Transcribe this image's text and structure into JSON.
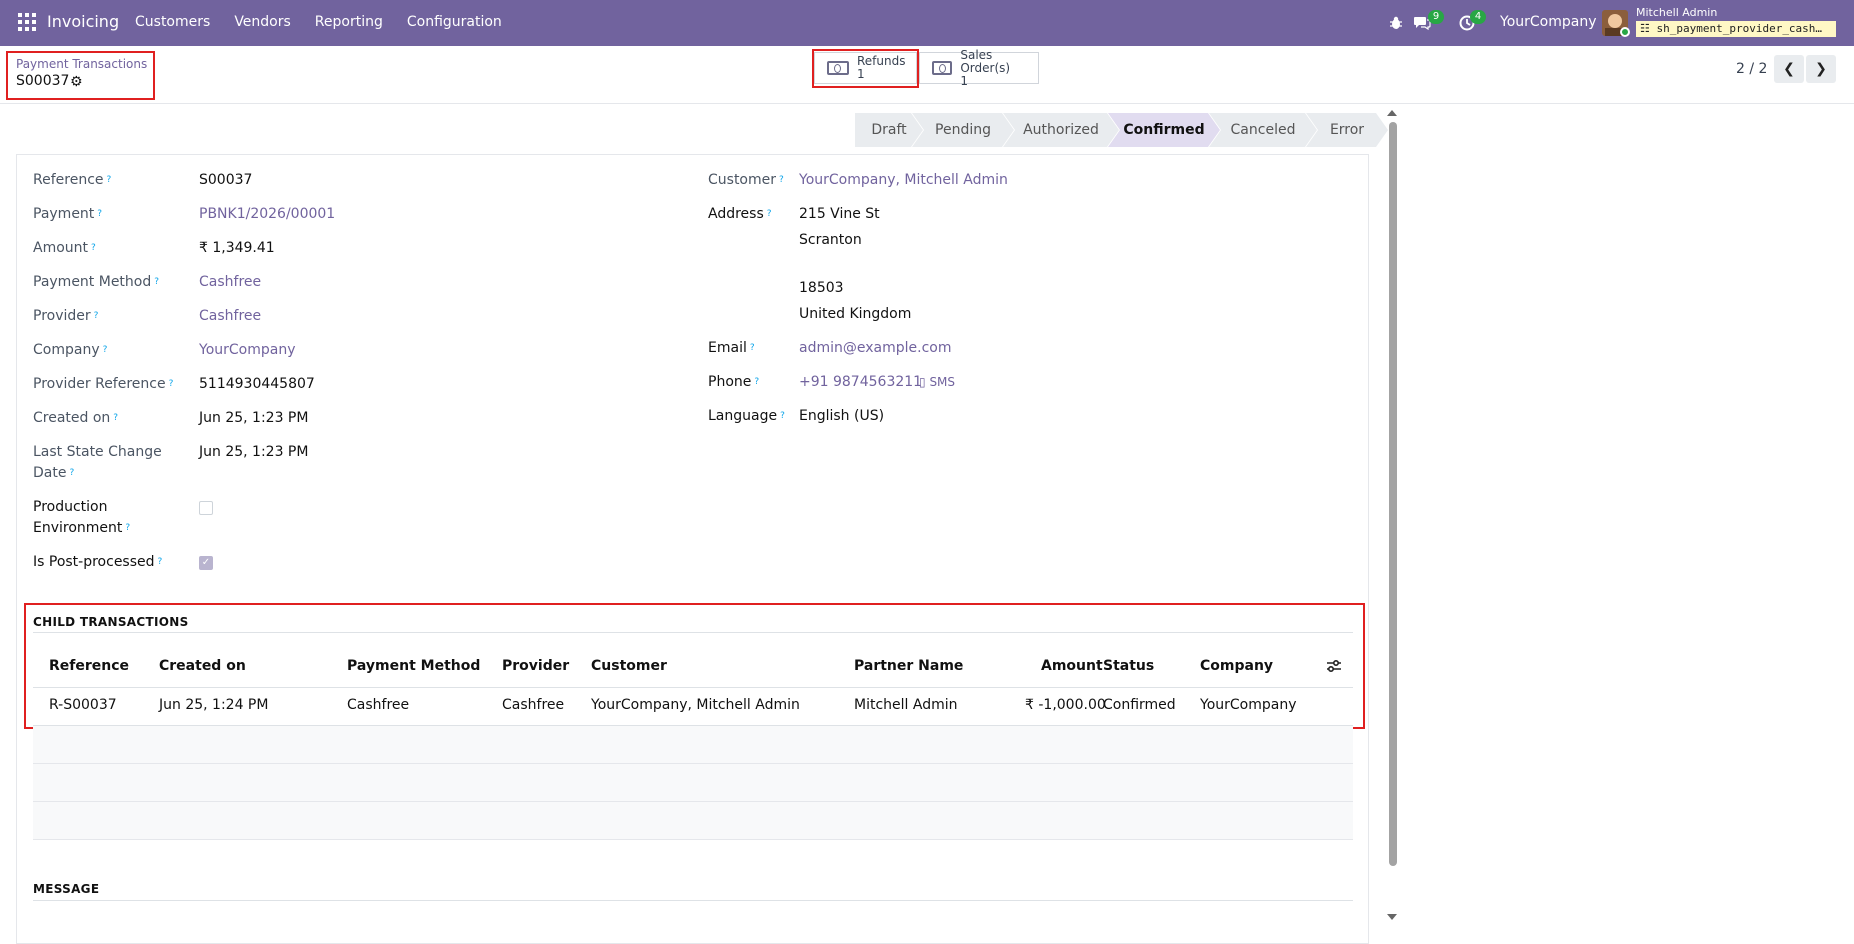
{
  "navbar": {
    "app_name": "Invoicing",
    "menu": [
      "Customers",
      "Vendors",
      "Reporting",
      "Configuration"
    ],
    "chat_count": "9",
    "activity_count": "4",
    "company": "YourCompany",
    "user_name": "Mitchell Admin",
    "database": "sh_payment_provider_cash…"
  },
  "breadcrumb": {
    "parent": "Payment Transactions",
    "current": "S00037"
  },
  "smart_buttons": {
    "refunds_label": "Refunds",
    "refunds_count": "1",
    "sales_label": "Sales Order(s)",
    "sales_count": "1"
  },
  "pager": {
    "value": "2 / 2"
  },
  "statusbar": [
    "Draft",
    "Pending",
    "Authorized",
    "Confirmed",
    "Canceled",
    "Error"
  ],
  "statusbar_active": "Confirmed",
  "left_fields": {
    "reference": {
      "label": "Reference",
      "value": "S00037"
    },
    "payment": {
      "label": "Payment",
      "value": "PBNK1/2026/00001"
    },
    "amount": {
      "label": "Amount",
      "value": "₹ 1,349.41"
    },
    "payment_method": {
      "label": "Payment Method",
      "value": "Cashfree"
    },
    "provider": {
      "label": "Provider",
      "value": "Cashfree"
    },
    "company": {
      "label": "Company",
      "value": "YourCompany"
    },
    "provider_reference": {
      "label": "Provider Reference",
      "value": "5114930445807"
    },
    "created_on": {
      "label": "Created on",
      "value": "Jun 25, 1:23 PM"
    },
    "last_state_change": {
      "label_line1": "Last State Change",
      "label_line2": "Date",
      "value": "Jun 25, 1:23 PM"
    },
    "production_env": {
      "label_line1": "Production",
      "label_line2": "Environment",
      "checked": false
    },
    "is_post_processed": {
      "label": "Is Post-processed",
      "checked": true
    }
  },
  "right_fields": {
    "customer": {
      "label": "Customer",
      "value": "YourCompany, Mitchell Admin"
    },
    "address": {
      "label": "Address",
      "line1": "215 Vine St",
      "line2": "Scranton",
      "line3": "18503",
      "line4": "United Kingdom"
    },
    "email": {
      "label": "Email",
      "value": "admin@example.com"
    },
    "phone": {
      "label": "Phone",
      "value": "+91 9874563211",
      "sms": "SMS"
    },
    "language": {
      "label": "Language",
      "value": "English (US)"
    }
  },
  "child_transactions": {
    "title": "CHILD TRANSACTIONS",
    "headers": [
      "Reference",
      "Created on",
      "Payment Method",
      "Provider",
      "Customer",
      "Partner Name",
      "Amount",
      "Status",
      "Company"
    ],
    "rows": [
      [
        "R-S00037",
        "Jun 25, 1:24 PM",
        "Cashfree",
        "Cashfree",
        "YourCompany, Mitchell Admin",
        "Mitchell Admin",
        "₹ -1,000.00",
        "Confirmed",
        "YourCompany"
      ]
    ]
  },
  "message_title": "MESSAGE",
  "colors": {
    "navbar": "#71639e",
    "link": "#71639e",
    "highlight": "#e02020",
    "badge": "#28a745"
  }
}
